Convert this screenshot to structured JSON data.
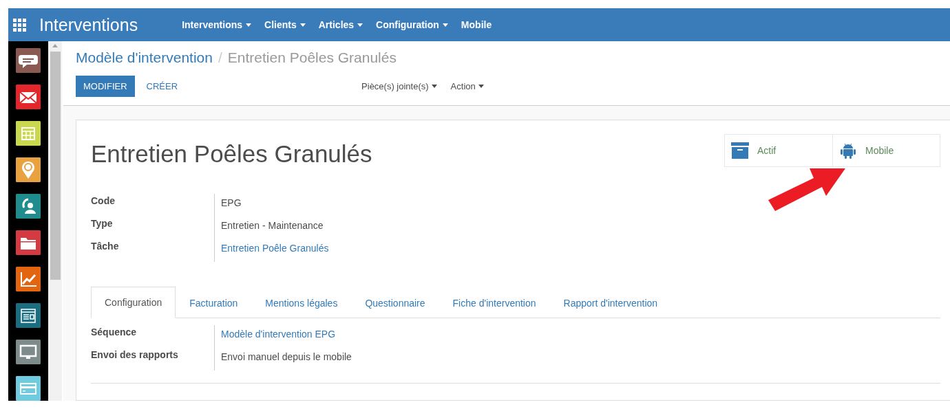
{
  "app": {
    "title": "Interventions"
  },
  "menu": [
    {
      "label": "Interventions",
      "dropdown": true
    },
    {
      "label": "Clients",
      "dropdown": true
    },
    {
      "label": "Articles",
      "dropdown": true
    },
    {
      "label": "Configuration",
      "dropdown": true
    },
    {
      "label": "Mobile",
      "dropdown": false
    }
  ],
  "sidebar": {
    "apps": [
      {
        "kind": "chat",
        "color": "#8a5a52"
      },
      {
        "kind": "mail",
        "color": "#e3262b"
      },
      {
        "kind": "calendar",
        "color": "#c9d84e"
      },
      {
        "kind": "pin",
        "color": "#e8a23f"
      },
      {
        "kind": "support",
        "color": "#1f8c8e"
      },
      {
        "kind": "folder",
        "color": "#d33a42"
      },
      {
        "kind": "chart",
        "color": "#e4650f"
      },
      {
        "kind": "document",
        "color": "#1b6e80"
      },
      {
        "kind": "monitor",
        "color": "#7d8b8b"
      },
      {
        "kind": "card",
        "color": "#6fcbe0"
      }
    ]
  },
  "breadcrumb": [
    {
      "label": "Modèle d'intervention",
      "link": true
    },
    {
      "label": "Entretien Poêles Granulés",
      "link": false
    }
  ],
  "separator": "/",
  "buttons": [
    {
      "label": "MODIFIER",
      "primary": true
    },
    {
      "label": "CRÉER",
      "primary": false
    }
  ],
  "sidebar_actions": [
    {
      "label": "Pièce(s) jointe(s)"
    },
    {
      "label": "Action"
    }
  ],
  "record": {
    "title": "Entretien Poêles Granulés",
    "smart_buttons": [
      {
        "kind": "archive",
        "label": "Actif"
      },
      {
        "kind": "android",
        "label": "Mobile"
      }
    ],
    "fields": [
      {
        "label": "Code",
        "value": "EPG",
        "link": false
      },
      {
        "label": "Type",
        "value": "Entretien - Maintenance",
        "link": false
      },
      {
        "label": "Tâche",
        "value": "Entretien Poêle Granulés",
        "link": true
      }
    ]
  },
  "tabs": [
    {
      "label": "Configuration",
      "selected": true
    },
    {
      "label": "Facturation",
      "selected": false
    },
    {
      "label": "Mentions légales",
      "selected": false
    },
    {
      "label": "Questionnaire",
      "selected": false
    },
    {
      "label": "Fiche d'intervention",
      "selected": false
    },
    {
      "label": "Rapport d'intervention",
      "selected": false
    }
  ],
  "tab_fields": [
    {
      "label": "Séquence",
      "value": "Modèle d'intervention EPG",
      "link": true
    },
    {
      "label": "Envoi des rapports",
      "value": "Envoi manuel depuis le mobile",
      "link": false
    }
  ]
}
